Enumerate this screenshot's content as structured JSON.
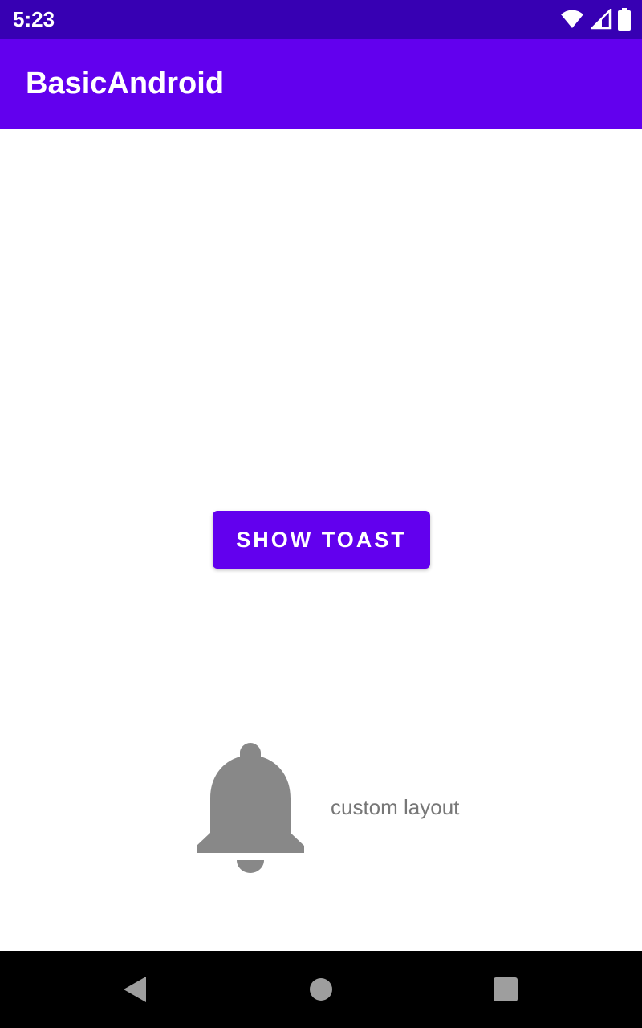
{
  "status_bar": {
    "time": "5:23",
    "icons": [
      "wifi-icon",
      "cell-signal-icon",
      "battery-icon"
    ]
  },
  "app_bar": {
    "title": "BasicAndroid"
  },
  "main": {
    "show_toast_label": "SHOW TOAST",
    "toast": {
      "icon": "bell-icon",
      "text": "custom layout"
    }
  },
  "nav_bar": {
    "buttons": [
      "back-icon",
      "home-icon",
      "recents-icon"
    ]
  },
  "colors": {
    "status_bar": "#3700B3",
    "primary": "#6200EE",
    "on_primary": "#FFFFFF",
    "icon_gray": "#888888",
    "nav_bar": "#000000"
  }
}
